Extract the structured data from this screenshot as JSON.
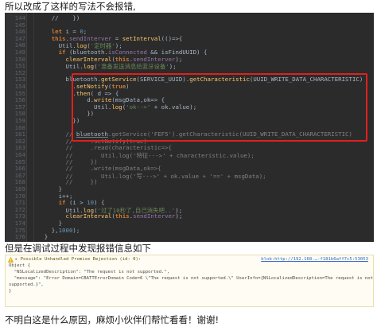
{
  "captions": {
    "top": "所以改成了这样的写法不会报错,",
    "middle": "但是在调试过程中发现报错信息如下",
    "bottom": "不明白这是什么原因，麻烦小伙伴们帮忙看看！谢谢!"
  },
  "colors": {
    "editor_bg": "#2b2b2b",
    "keyword": "#cc7832",
    "method": "#ffc66d",
    "string": "#6a8759",
    "number": "#6897bb",
    "highlight": "#e0201c"
  },
  "editor": {
    "lines": [
      {
        "num": "144",
        "parts": [
          [
            "p",
            "      //    })"
          ]
        ]
      },
      {
        "num": "145",
        "parts": []
      },
      {
        "num": "146",
        "parts": [
          [
            "k",
            "      let "
          ],
          [
            "p",
            "i = "
          ],
          [
            "n",
            "0"
          ],
          [
            "p",
            ";"
          ]
        ]
      },
      {
        "num": "147",
        "parts": [
          [
            "k",
            "      this"
          ],
          [
            "p",
            "."
          ],
          [
            "v",
            "sendInterver"
          ],
          [
            "p",
            " = "
          ],
          [
            "m",
            "setInterval"
          ],
          [
            "p",
            "(()=>{"
          ]
        ]
      },
      {
        "num": "148",
        "parts": [
          [
            "p",
            "        Util."
          ],
          [
            "m",
            "log"
          ],
          [
            "p",
            "("
          ],
          [
            "s",
            "'定时器'"
          ],
          [
            "p",
            ");"
          ]
        ]
      },
      {
        "num": "149",
        "parts": [
          [
            "k",
            "        if "
          ],
          [
            "p",
            "(bluetooth."
          ],
          [
            "v",
            "isConnected"
          ],
          [
            "p",
            " && isFindUUID) {"
          ]
        ]
      },
      {
        "num": "150",
        "parts": [
          [
            "m",
            "          clearInterval"
          ],
          [
            "p",
            "("
          ],
          [
            "k",
            "this"
          ],
          [
            "p",
            "."
          ],
          [
            "v",
            "sendInterver"
          ],
          [
            "p",
            ");"
          ]
        ]
      },
      {
        "num": "151",
        "parts": [
          [
            "p",
            "          Util."
          ],
          [
            "m",
            "log"
          ],
          [
            "p",
            "("
          ],
          [
            "s",
            "'准备发送消息给蓝牙设备'"
          ],
          [
            "p",
            ");"
          ]
        ]
      },
      {
        "num": "152",
        "parts": []
      },
      {
        "num": "153",
        "parts": [
          [
            "p",
            "          bluetooth."
          ],
          [
            "m",
            "getService"
          ],
          [
            "p",
            "(SERVICE_UUID)."
          ],
          [
            "m",
            "getCharacteristic"
          ],
          [
            "p",
            "(UUID_WRITE_DATA_CHARACTERISTIC)"
          ]
        ]
      },
      {
        "num": "154",
        "parts": [
          [
            "p",
            "            ."
          ],
          [
            "m",
            "setNotify"
          ],
          [
            "p",
            "("
          ],
          [
            "k",
            "true"
          ],
          [
            "p",
            ")"
          ]
        ]
      },
      {
        "num": "155",
        "parts": [
          [
            "p",
            "            ."
          ],
          [
            "m",
            "then"
          ],
          [
            "p",
            "( d => {"
          ]
        ]
      },
      {
        "num": "156",
        "parts": [
          [
            "p",
            "                d."
          ],
          [
            "m",
            "write"
          ],
          [
            "p",
            "(msgData,ok=> {"
          ]
        ]
      },
      {
        "num": "157",
        "parts": [
          [
            "p",
            "                  Util."
          ],
          [
            "m",
            "log"
          ],
          [
            "p",
            "("
          ],
          [
            "s",
            "'ok-->'"
          ],
          [
            "p",
            " + ok.value);"
          ]
        ]
      },
      {
        "num": "158",
        "parts": [
          [
            "p",
            "                })"
          ]
        ]
      },
      {
        "num": "159",
        "parts": [
          [
            "p",
            "            })"
          ]
        ]
      },
      {
        "num": "160",
        "parts": []
      },
      {
        "num": "161",
        "parts": [
          [
            "c",
            "          // "
          ],
          [
            "uc",
            "bluetooth"
          ],
          [
            "c",
            ".getService('FEF5').getCharacteristic(UUID_WRITE_DATA_CHARACTERISTIC)"
          ]
        ]
      },
      {
        "num": "162",
        "parts": [
          [
            "c",
            "          //     .setNotify(true)"
          ]
        ]
      },
      {
        "num": "163",
        "parts": [
          [
            "c",
            "          //     .read(characteristic=>{"
          ]
        ]
      },
      {
        "num": "164",
        "parts": [
          [
            "c",
            "          //        Util.log('特征--->' + characteristic.value);"
          ]
        ]
      },
      {
        "num": "165",
        "parts": [
          [
            "c",
            "          //     })"
          ]
        ]
      },
      {
        "num": "166",
        "parts": [
          [
            "c",
            "          //     .write(msgData,ok=>{"
          ]
        ]
      },
      {
        "num": "167",
        "parts": [
          [
            "c",
            "          //        Util.log('写--->' + ok.value + '==' + msgData);"
          ]
        ]
      },
      {
        "num": "168",
        "parts": [
          [
            "c",
            "          //     })"
          ]
        ]
      },
      {
        "num": "169",
        "parts": [
          [
            "p",
            "        }"
          ]
        ]
      },
      {
        "num": "170",
        "parts": [
          [
            "p",
            "        i++;"
          ]
        ]
      },
      {
        "num": "171",
        "parts": [
          [
            "k",
            "        if "
          ],
          [
            "p",
            "(i > "
          ],
          [
            "n",
            "10"
          ],
          [
            "p",
            ") {"
          ]
        ]
      },
      {
        "num": "172",
        "parts": [
          [
            "p",
            "          Util."
          ],
          [
            "m",
            "log"
          ],
          [
            "p",
            "("
          ],
          [
            "s",
            "'过了10秒了,自己消失吧..'"
          ],
          [
            "p",
            ");"
          ]
        ]
      },
      {
        "num": "173",
        "parts": [
          [
            "m",
            "          clearInterval"
          ],
          [
            "p",
            "("
          ],
          [
            "k",
            "this"
          ],
          [
            "p",
            "."
          ],
          [
            "v",
            "sendInterver"
          ],
          [
            "p",
            ");"
          ]
        ]
      },
      {
        "num": "174",
        "parts": [
          [
            "p",
            "        }"
          ]
        ]
      },
      {
        "num": "175",
        "parts": [
          [
            "p",
            "      },"
          ],
          [
            "n",
            "1000"
          ],
          [
            "p",
            ");"
          ]
        ]
      },
      {
        "num": "176",
        "parts": [
          [
            "p",
            "    }"
          ]
        ]
      }
    ]
  },
  "console": {
    "warning": "▸ Possible Unhandled Promise Rejection (id: 0):",
    "object": "Object {",
    "desc": "  \"NSLocalizedDescription\": \"The request is not supported.\",",
    "message": "  \"message\": \"Error Domain=CBATTErrorDomain Code=6 \\\"The request is not supported.\\\" UserInfo={NSLocalizedDescription=The request is not",
    "message_cont": "supported.}\",",
    "close": "}",
    "link": "blob:http://192.168.…-f181b6aff7c5:53053"
  }
}
